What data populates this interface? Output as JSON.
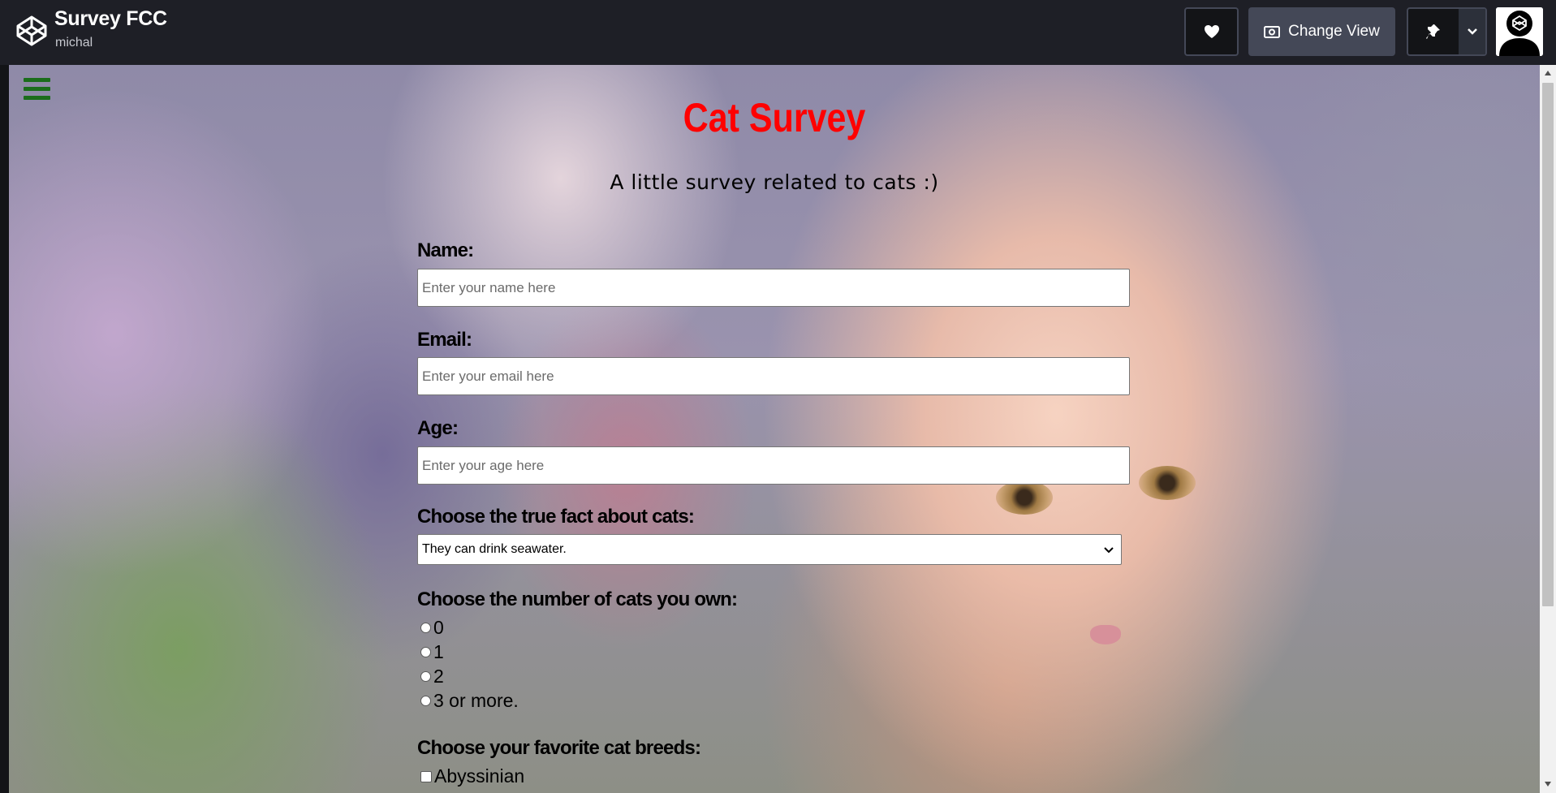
{
  "header": {
    "project_title": "Survey FCC",
    "author": "michal",
    "change_view_label": "Change View",
    "icons": [
      "codepen-logo-icon",
      "heart-icon",
      "change-view-icon",
      "pin-icon",
      "chevron-down-icon",
      "user-avatar"
    ]
  },
  "survey": {
    "title": "Cat Survey",
    "description": "A little survey related to cats :)",
    "name": {
      "label": "Name:",
      "placeholder": "Enter your name here"
    },
    "email": {
      "label": "Email:",
      "placeholder": "Enter your email here"
    },
    "age": {
      "label": "Age:",
      "placeholder": "Enter your age here"
    },
    "fact": {
      "label": "Choose the true fact about cats:",
      "selected": "They can drink seawater."
    },
    "cats_owned": {
      "label": "Choose the number of cats you own:",
      "options": [
        "0",
        "1",
        "2",
        "3 or more."
      ]
    },
    "breeds": {
      "label": "Choose your favorite cat breeds:",
      "options": [
        "Abyssinian"
      ]
    }
  },
  "colors": {
    "title": "#ff0000",
    "hamburger": "#1b6d1b",
    "topbar": "#1e1f26",
    "change_view_button": "#444857"
  }
}
